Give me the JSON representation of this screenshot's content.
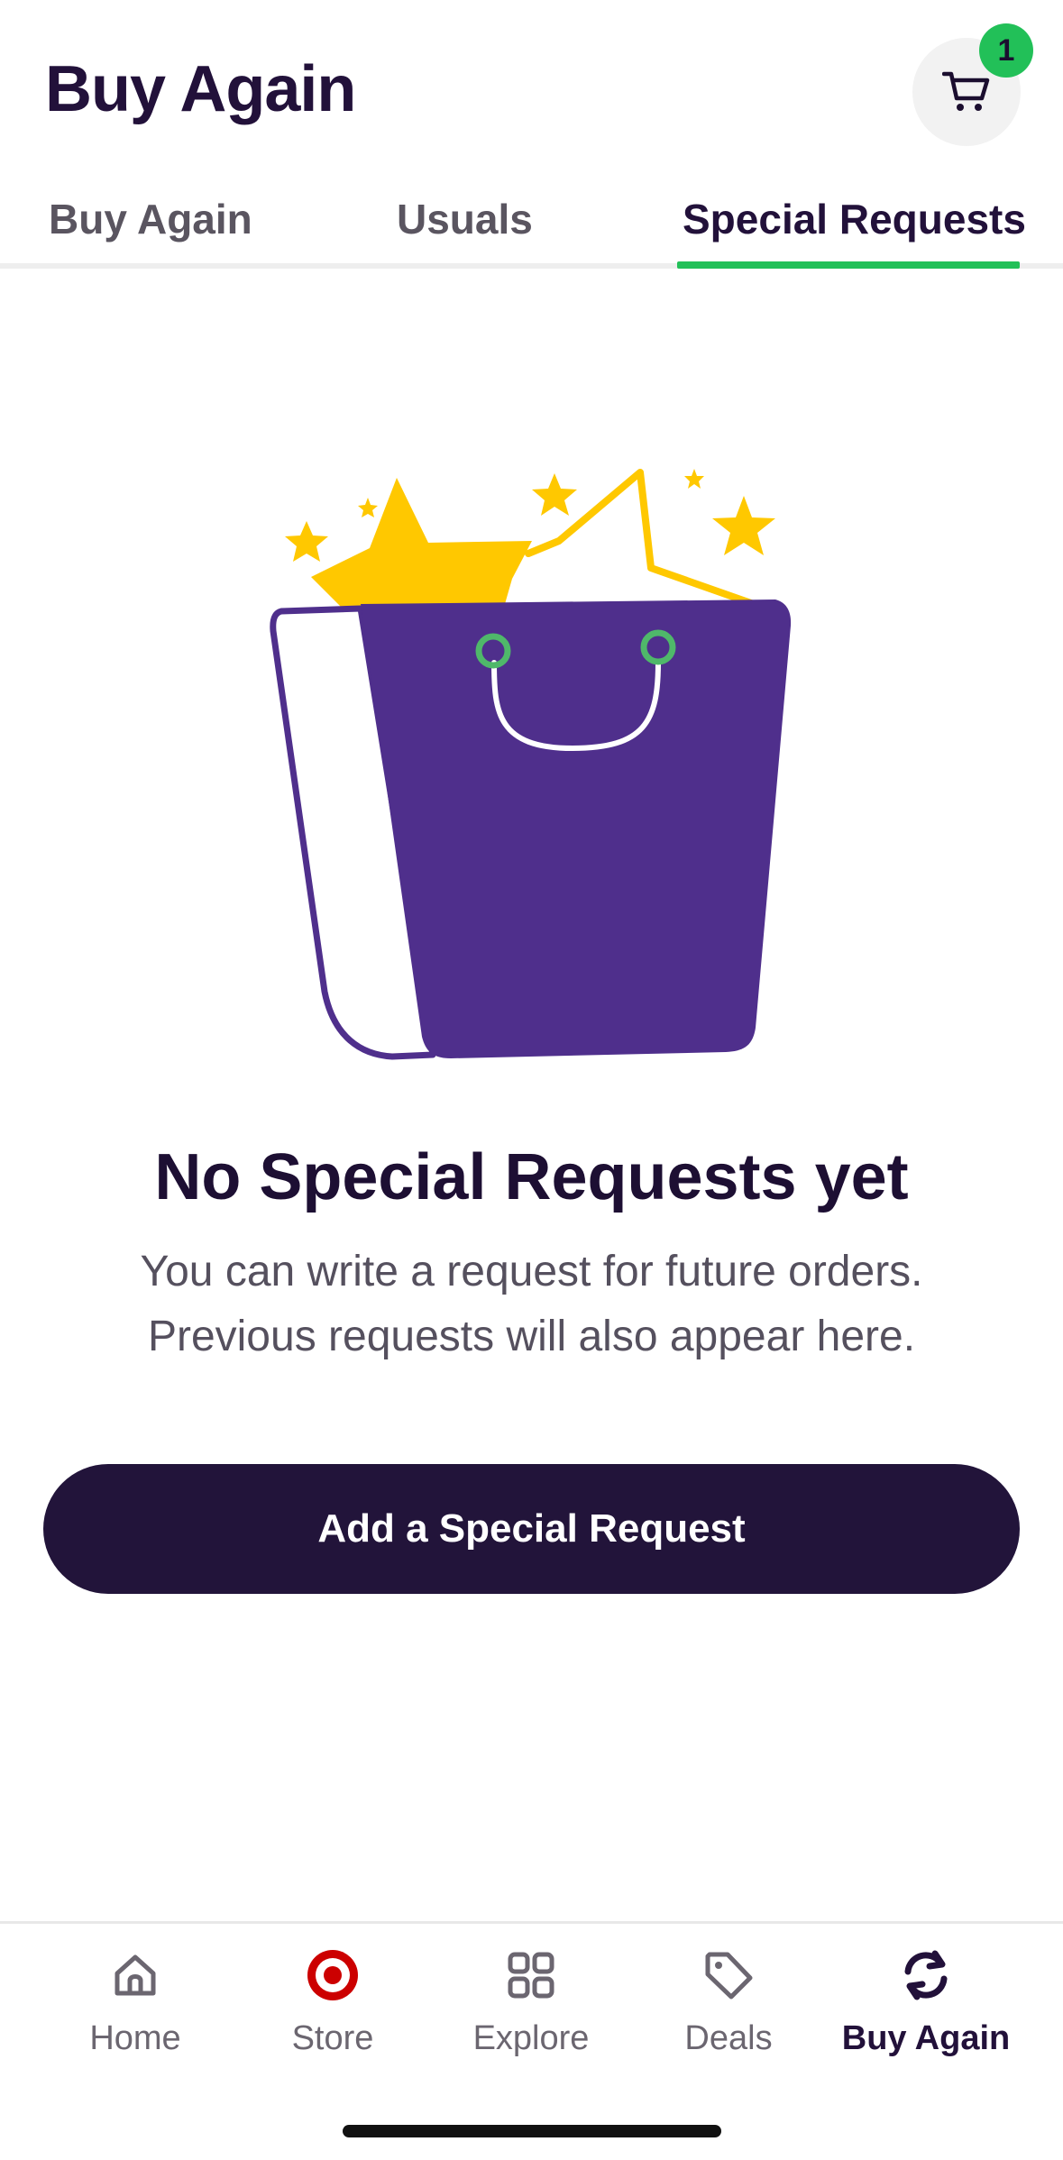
{
  "header": {
    "title": "Buy Again",
    "cart_count": "1"
  },
  "tabs": [
    {
      "label": "Buy Again",
      "active": false
    },
    {
      "label": "Usuals",
      "active": false
    },
    {
      "label": "Special Requests",
      "active": true
    }
  ],
  "empty_state": {
    "title": "No Special Requests yet",
    "line1": "You can write a request for future orders.",
    "line2": "Previous requests will also appear here.",
    "button_label": "Add a Special Request"
  },
  "bottom_nav": [
    {
      "label": "Home",
      "icon": "home-icon",
      "active": false
    },
    {
      "label": "Store",
      "icon": "target-icon",
      "active": false
    },
    {
      "label": "Explore",
      "icon": "grid-icon",
      "active": false
    },
    {
      "label": "Deals",
      "icon": "tag-icon",
      "active": false
    },
    {
      "label": "Buy Again",
      "icon": "refresh-icon",
      "active": true
    }
  ],
  "colors": {
    "accent_green": "#22c058",
    "primary_dark": "#22143a",
    "bag_purple": "#4f2f8c",
    "star_yellow": "#ffc800",
    "target_red": "#cc0000"
  }
}
